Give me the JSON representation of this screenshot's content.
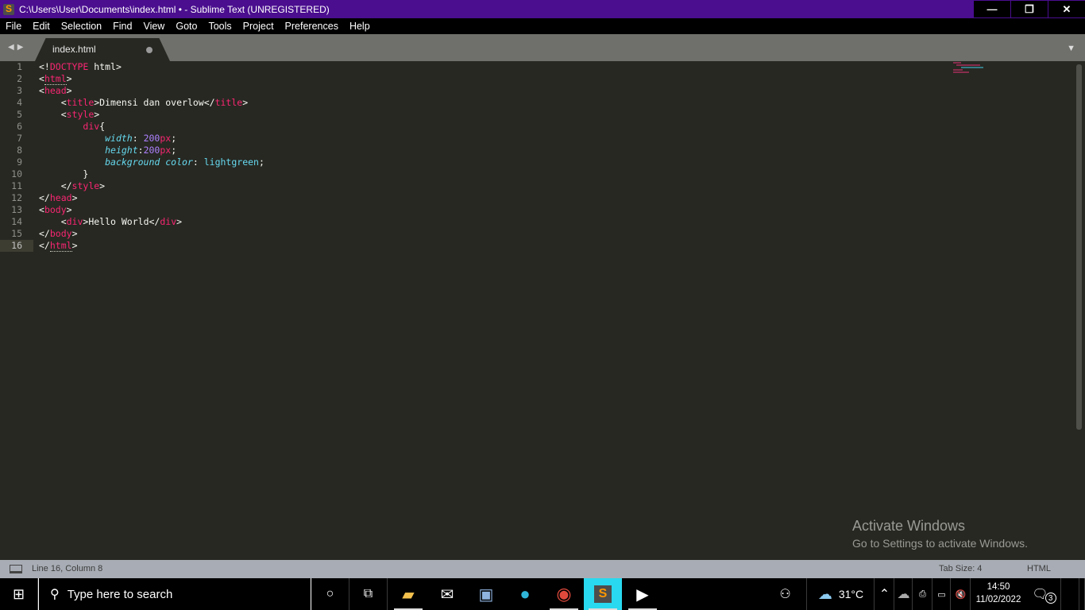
{
  "window": {
    "title": "C:\\Users\\User\\Documents\\index.html • - Sublime Text (UNREGISTERED)",
    "controls": {
      "minimize": "—",
      "restore": "❐",
      "close": "✕"
    }
  },
  "menu": [
    "File",
    "Edit",
    "Selection",
    "Find",
    "View",
    "Goto",
    "Tools",
    "Project",
    "Preferences",
    "Help"
  ],
  "tabs": [
    {
      "label": "index.html",
      "modified": true
    }
  ],
  "editor": {
    "line_numbers": [
      "1",
      "2",
      "3",
      "4",
      "5",
      "6",
      "7",
      "8",
      "9",
      "10",
      "11",
      "12",
      "13",
      "14",
      "15",
      "16"
    ],
    "active_line": 16
  },
  "watermark": {
    "title": "Activate Windows",
    "subtitle": "Go to Settings to activate Windows."
  },
  "statusbar": {
    "position": "Line 16, Column 8",
    "tab_size": "Tab Size: 4",
    "syntax": "HTML"
  },
  "taskbar": {
    "search_placeholder": "Type here to search",
    "apps": [
      "file-explorer",
      "mail",
      "remote-desktop",
      "edge",
      "chrome",
      "sublime-text",
      "video-editor"
    ],
    "weather": "31°C",
    "time": "14:50",
    "date": "11/02/2022",
    "notifications": "3"
  },
  "colors": {
    "titlebar": "#4a0e8f",
    "editor_bg": "#272822",
    "tag": "#f92672",
    "attr": "#66d9ef",
    "number": "#ae81ff",
    "taskbar_active": "#29d9ef"
  }
}
